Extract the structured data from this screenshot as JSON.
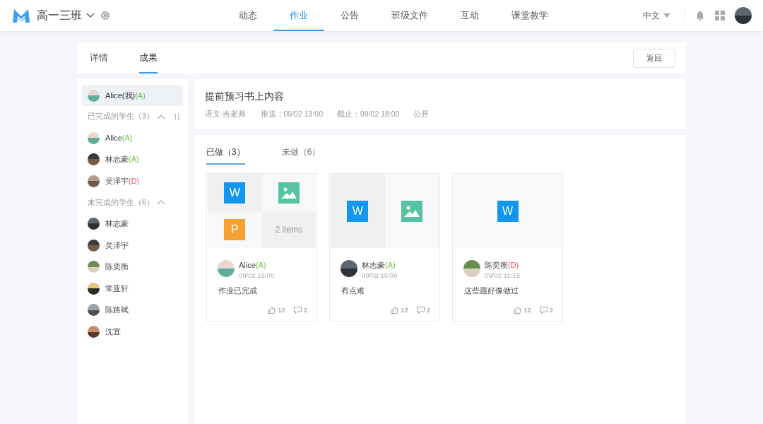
{
  "topbar": {
    "class_name": "高一三班",
    "nav": [
      {
        "label": "动态",
        "selected": false
      },
      {
        "label": "作业",
        "selected": true
      },
      {
        "label": "公告",
        "selected": false
      },
      {
        "label": "班级文件",
        "selected": false
      },
      {
        "label": "互动",
        "selected": false
      },
      {
        "label": "课堂教学",
        "selected": false
      }
    ],
    "language": "中文"
  },
  "page_tabs": [
    {
      "label": "详情",
      "selected": false
    },
    {
      "label": "成果",
      "selected": true
    }
  ],
  "back_button": "返回",
  "sidebar": {
    "me": {
      "name": "Alice(我)",
      "grade": {
        "text": "(A)",
        "color": "#6cc24a"
      },
      "selected": true
    },
    "groups": [
      {
        "title": "已完成的学生（3）",
        "expanded": true,
        "sortable": true,
        "students": [
          {
            "name": "Alice",
            "grade": {
              "text": "(A)",
              "color": "#6cc24a"
            }
          },
          {
            "name": "林志豪",
            "grade": {
              "text": "(A)",
              "color": "#6cc24a"
            }
          },
          {
            "name": "吴泽宇",
            "grade": {
              "text": "(D)",
              "color": "#e8595b"
            }
          }
        ]
      },
      {
        "title": "未完成的学生（6）",
        "expanded": true,
        "sortable": false,
        "students": [
          {
            "name": "林志豪"
          },
          {
            "name": "吴泽宇"
          },
          {
            "name": "陈奕衡"
          },
          {
            "name": "常亚轩"
          },
          {
            "name": "陈路斌"
          },
          {
            "name": "沈宜"
          }
        ]
      }
    ]
  },
  "task": {
    "title": "提前预习书上内容",
    "subject": "语文·吉老师",
    "pushed": "推送：09/02 13:00",
    "deadline": "截止：09/02 18:00",
    "visibility": "公开"
  },
  "result_tabs": [
    {
      "label": "已做（3）",
      "selected": true
    },
    {
      "label": "未做（6）",
      "selected": false
    }
  ],
  "submissions": [
    {
      "files": [
        {
          "kind": "word",
          "label": "W"
        },
        {
          "kind": "image"
        },
        {
          "kind": "ppt",
          "label": "P"
        },
        {
          "kind": "more",
          "label": "2 items"
        }
      ],
      "name": "Alice",
      "grade": {
        "text": "(A)",
        "color": "#6cc24a"
      },
      "time": "09/02 15:00",
      "comment": "作业已完成",
      "likes": "12",
      "comments": "2"
    },
    {
      "files": [
        {
          "kind": "word",
          "label": "W"
        },
        {
          "kind": "image"
        }
      ],
      "name": "林志豪",
      "grade": {
        "text": "(A)",
        "color": "#6cc24a"
      },
      "time": "09/02 15:09",
      "comment": "有点难",
      "likes": "12",
      "comments": "2"
    },
    {
      "files": [
        {
          "kind": "word",
          "label": "W"
        }
      ],
      "name": "陈奕衡",
      "grade": {
        "text": "(D)",
        "color": "#e8595b"
      },
      "time": "09/02 15:15",
      "comment": "这些题好像做过",
      "likes": "12",
      "comments": "2"
    }
  ]
}
